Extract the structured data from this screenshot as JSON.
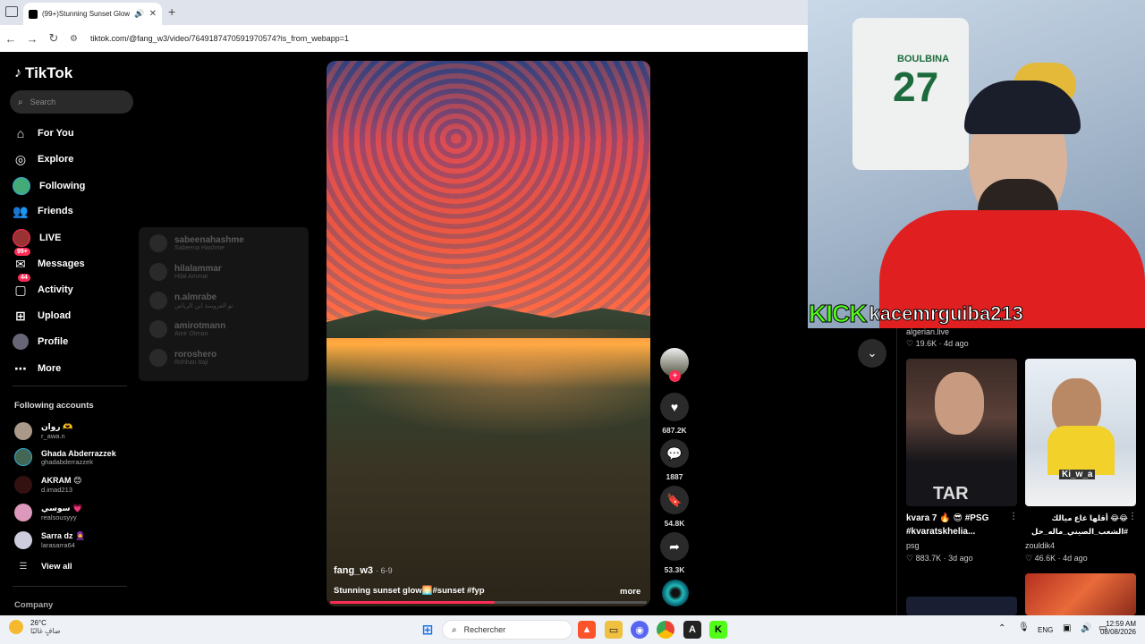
{
  "browser": {
    "tab_title": "(99+)Stunning Sunset Glow",
    "url": "tiktok.com/@fang_w3/video/7649187470591970574?is_from_webapp=1",
    "new_tab": "+"
  },
  "sidebar": {
    "logo": "TikTok",
    "search_placeholder": "Search",
    "nav": [
      {
        "label": "For You",
        "icon": "home-icon"
      },
      {
        "label": "Explore",
        "icon": "compass-icon"
      },
      {
        "label": "Following",
        "icon": "avatar"
      },
      {
        "label": "Friends",
        "icon": "friends-icon"
      },
      {
        "label": "LIVE",
        "icon": "live-icon"
      },
      {
        "label": "Messages",
        "icon": "messages-icon",
        "badge": "99+"
      },
      {
        "label": "Activity",
        "icon": "activity-icon",
        "badge": "44"
      },
      {
        "label": "Upload",
        "icon": "upload-icon"
      },
      {
        "label": "Profile",
        "icon": "avatar"
      },
      {
        "label": "More",
        "icon": "more-icon"
      }
    ],
    "following_title": "Following accounts",
    "accounts": [
      {
        "name": "روان 🫶",
        "handle": "r_awa.n"
      },
      {
        "name": "Ghada Abderrazzek",
        "handle": "ghadabderrazzek"
      },
      {
        "name": "AKRAM 😊",
        "handle": "d.imad213"
      },
      {
        "name": "سوسي 💗",
        "handle": "realsousyyy"
      },
      {
        "name": "Sarra dz 🧕",
        "handle": "larasarra64"
      }
    ],
    "view_all": "View all",
    "company": "Company"
  },
  "suggestions": [
    {
      "user": "sabeenahashme",
      "name": "Sabeena Hashme"
    },
    {
      "user": "hilalammar",
      "name": "Hilal Ammar"
    },
    {
      "user": "n.almrabe",
      "name": "نو العروسة ابن الرياض"
    },
    {
      "user": "amirotmann",
      "name": "Amir Otman"
    },
    {
      "user": "roroshero",
      "name": "Rohhan Itaji"
    }
  ],
  "video": {
    "author": "fang_w3",
    "date": "· 6-9",
    "caption": "Stunning sunset glow🌅#sunset #fyp",
    "more": "more",
    "progress": 0.52,
    "likes": "687.2K",
    "comments": "1887",
    "saves": "54.8K",
    "shares": "53.3K"
  },
  "stream": {
    "kick": "KICK",
    "channel": "kacemrguiba213",
    "jersey_name": "BOULBINA",
    "jersey_number": "27"
  },
  "right_panel": {
    "top_user": "algerian.live",
    "top_stat": "♡ 19.6K · 4d ago",
    "cards": [
      {
        "title": "kvara 7 🔥 😎 #PSG #kvaratskhelia...",
        "user": "psg",
        "stat": "♡ 883.7K · 3d ago",
        "overlay": "TAR"
      },
      {
        "title": "😂😂 أقلها غاع ميالك #الشعب_الصيني_ماله_حل 😂😂",
        "user": "zouldik4",
        "stat": "♡ 46.6K · 4d ago",
        "overlay": "Ki_w_a"
      }
    ]
  },
  "taskbar": {
    "weather_temp": "26°C",
    "weather_desc": "صافٍ غالبًا",
    "search": "Rechercher",
    "lang": "ENG",
    "time": "12:59 AM",
    "date": "08/08/2026"
  }
}
